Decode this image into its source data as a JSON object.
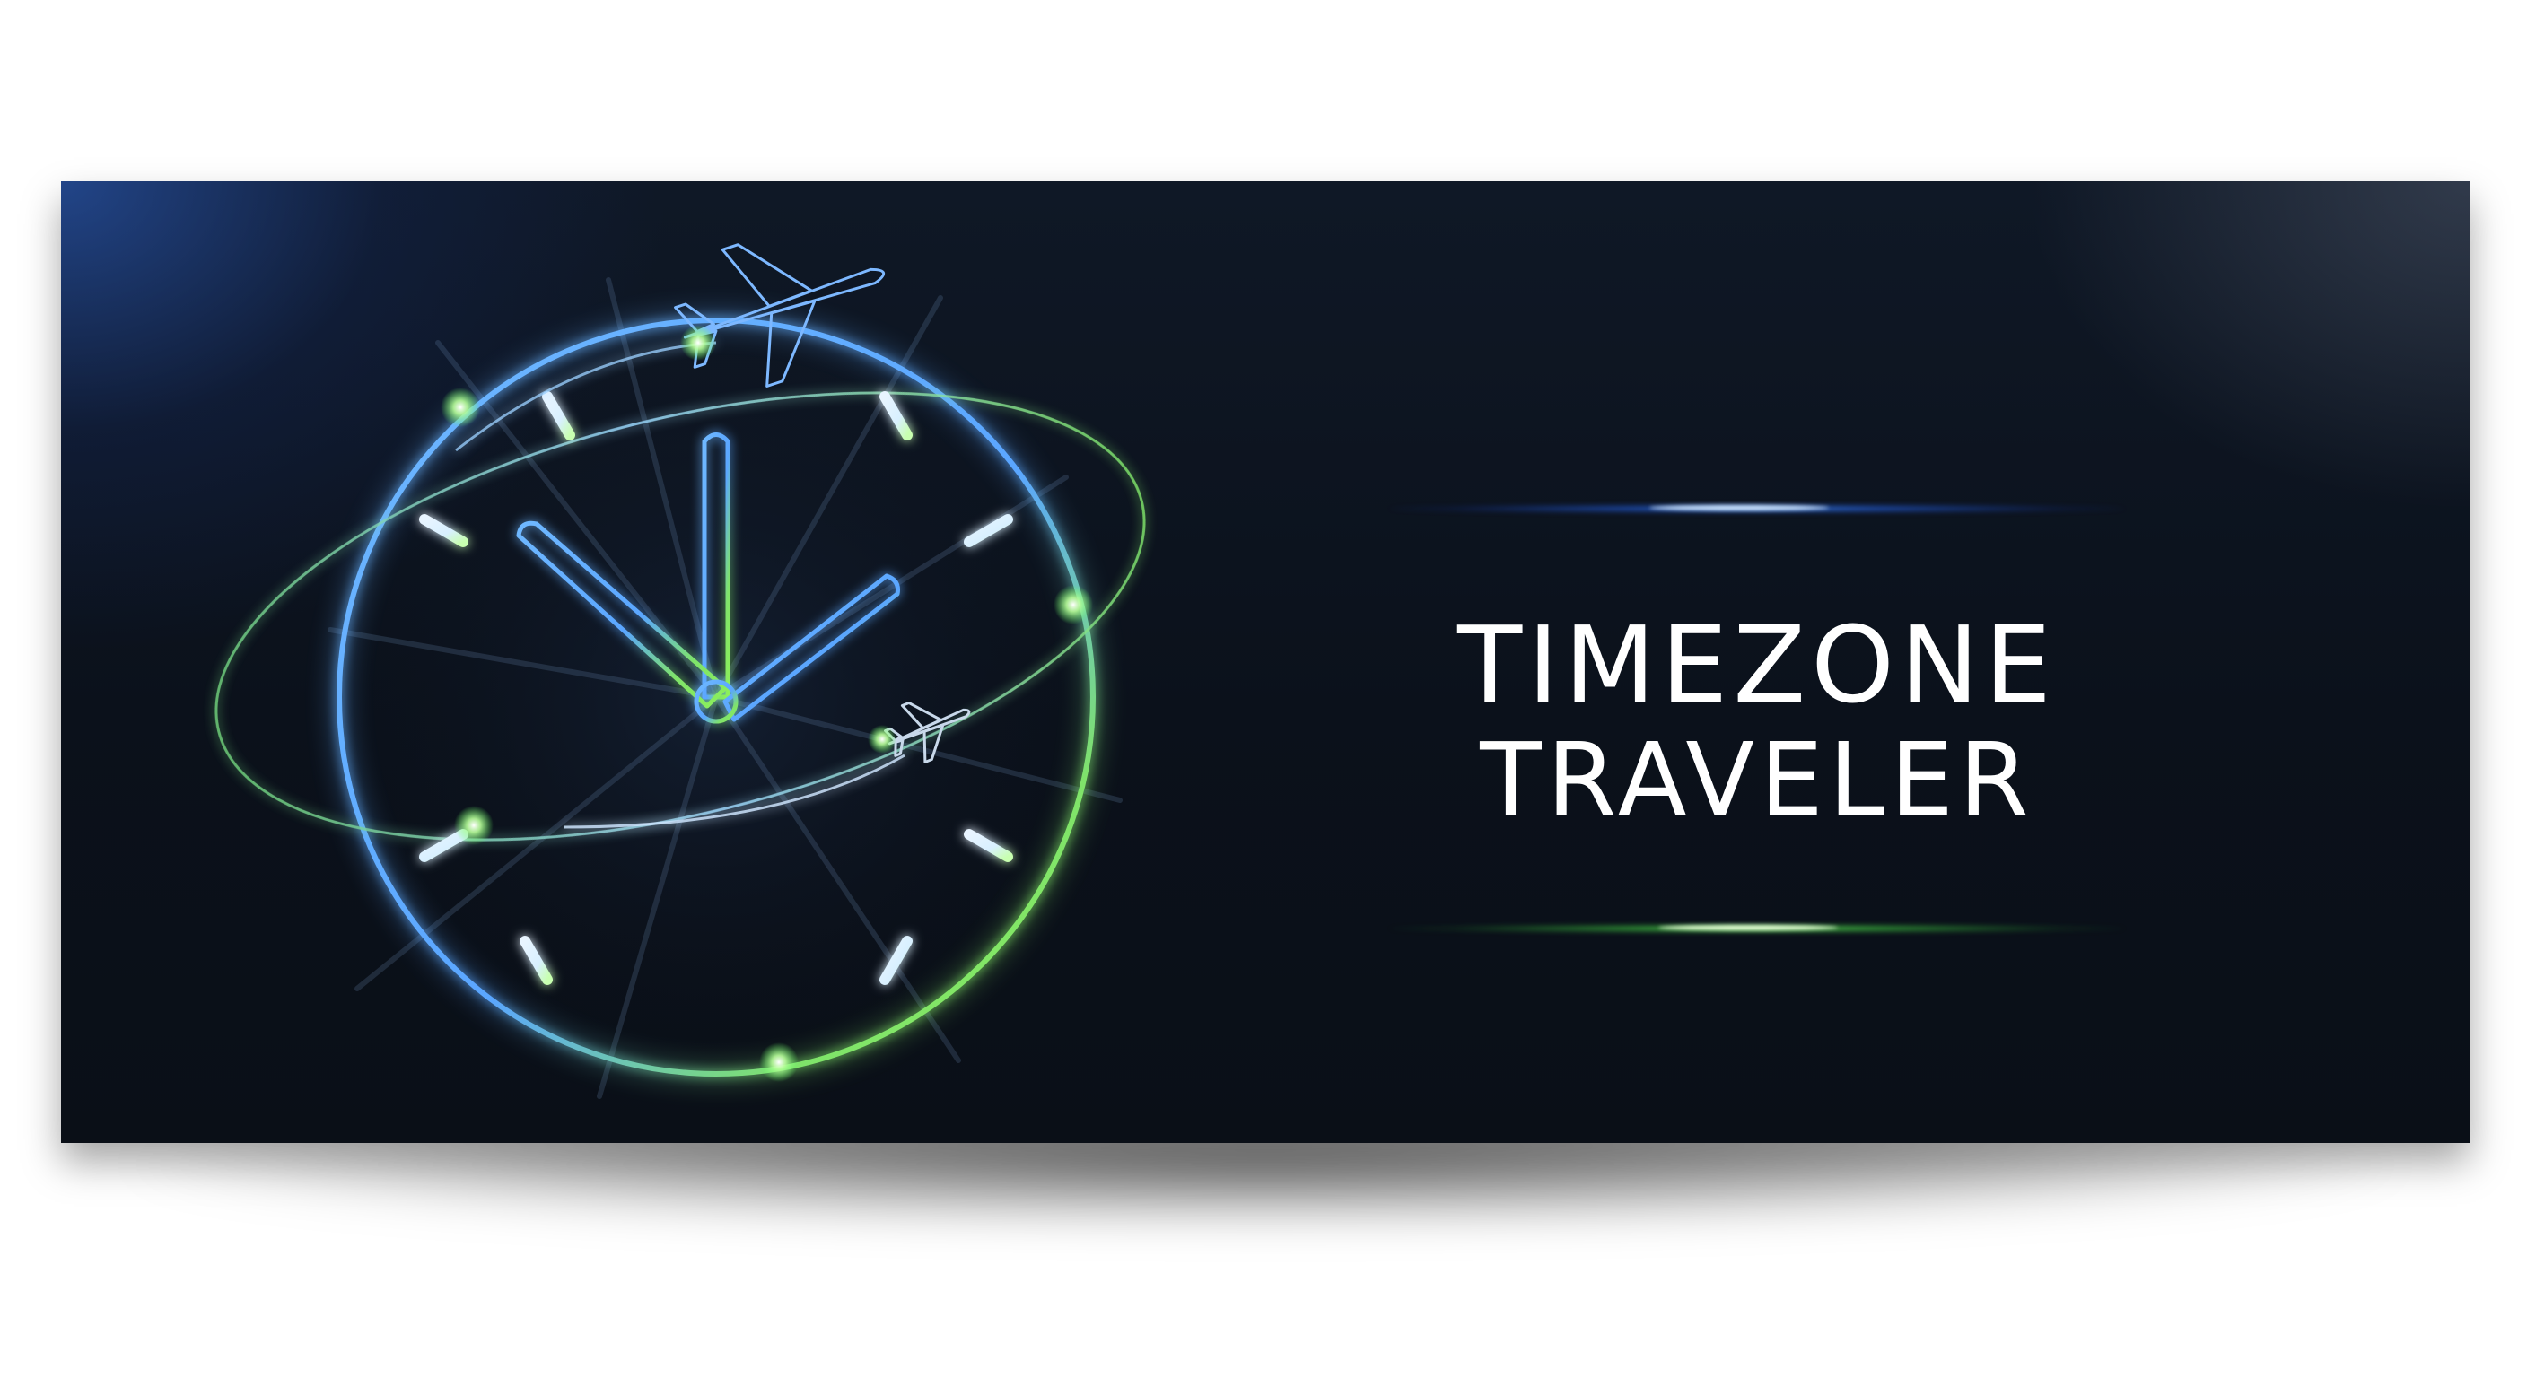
{
  "banner": {
    "title_line_1": "TIMEZONE",
    "title_line_2": "TRAVELER"
  },
  "artwork": {
    "icons": [
      "clock-icon",
      "airplane-icon",
      "airplane-icon"
    ]
  },
  "colors": {
    "background": "#0b111b",
    "accent_blue": "#5fb4ff",
    "accent_green": "#6eea4a",
    "text": "#ffffff"
  }
}
